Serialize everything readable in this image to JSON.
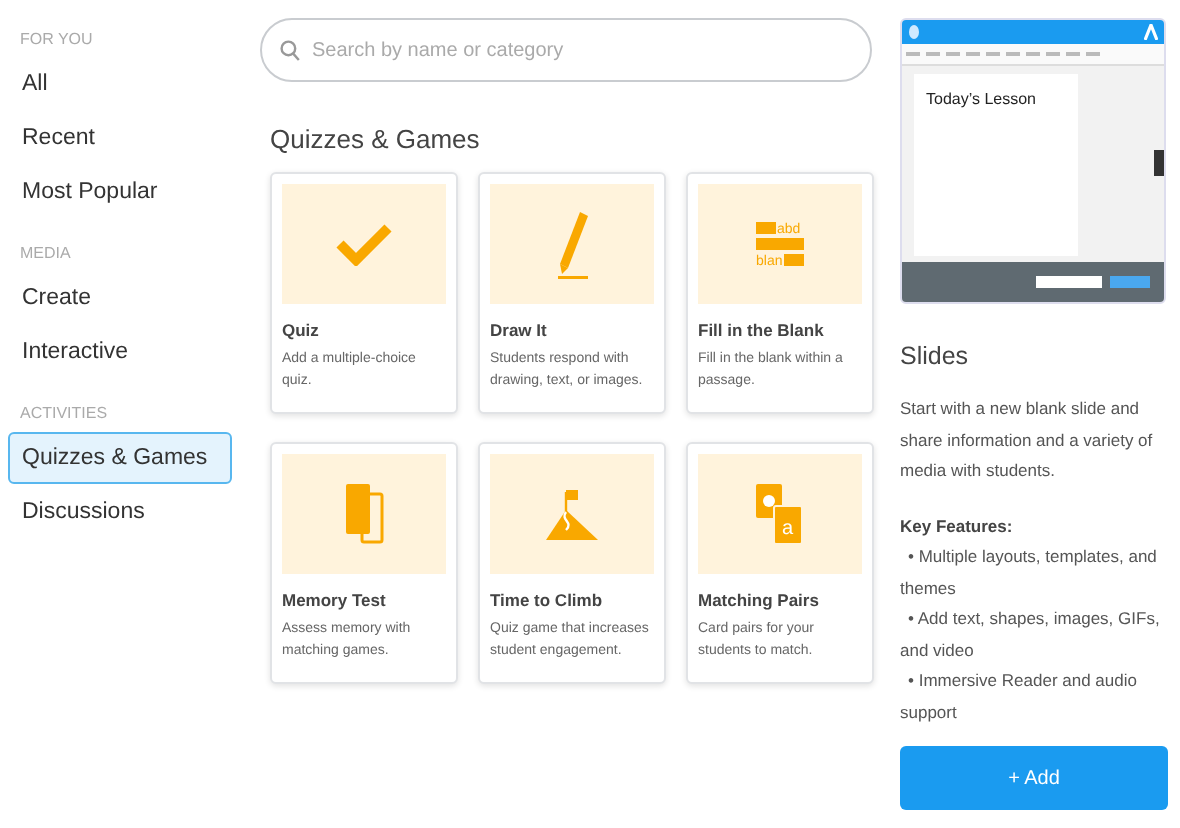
{
  "sidebar": {
    "sections": [
      {
        "heading": "FOR YOU",
        "items": [
          {
            "label": "All",
            "selected": false
          },
          {
            "label": "Recent",
            "selected": false
          },
          {
            "label": "Most Popular",
            "selected": false
          }
        ]
      },
      {
        "heading": "MEDIA",
        "items": [
          {
            "label": "Create",
            "selected": false
          },
          {
            "label": "Interactive",
            "selected": false
          }
        ]
      },
      {
        "heading": "ACTIVITIES",
        "items": [
          {
            "label": "Quizzes & Games",
            "selected": true
          },
          {
            "label": "Discussions",
            "selected": false
          }
        ]
      }
    ]
  },
  "search": {
    "placeholder": "Search by name or category"
  },
  "section_title": "Quizzes & Games",
  "cards": [
    {
      "title": "Quiz",
      "description": "Add a multiple-choice quiz."
    },
    {
      "title": "Draw It",
      "description": "Students respond with drawing, text, or images."
    },
    {
      "glyphs": [
        "abd",
        "blan"
      ],
      "title": "Fill in the Blank",
      "description": "Fill in the blank within a passage."
    },
    {
      "title": "Memory Test",
      "description": "Assess memory with matching games."
    },
    {
      "title": "Time to Climb",
      "description": "Quiz game that increases student engagement."
    },
    {
      "glyphs": [
        "a"
      ],
      "title": "Matching Pairs",
      "description": "Card pairs for your students to match."
    }
  ],
  "preview": {
    "slide_title": "Today’s Lesson"
  },
  "detail": {
    "title": "Slides",
    "description": "Start with a new blank slide and share information and a variety of media with students.",
    "features_heading": "Key Features:",
    "features": [
      "• Multiple layouts, templates, and themes",
      "• Add text, shapes, images, GIFs, and video",
      "• Immersive Reader and audio support"
    ],
    "add_button": "+ Add"
  }
}
